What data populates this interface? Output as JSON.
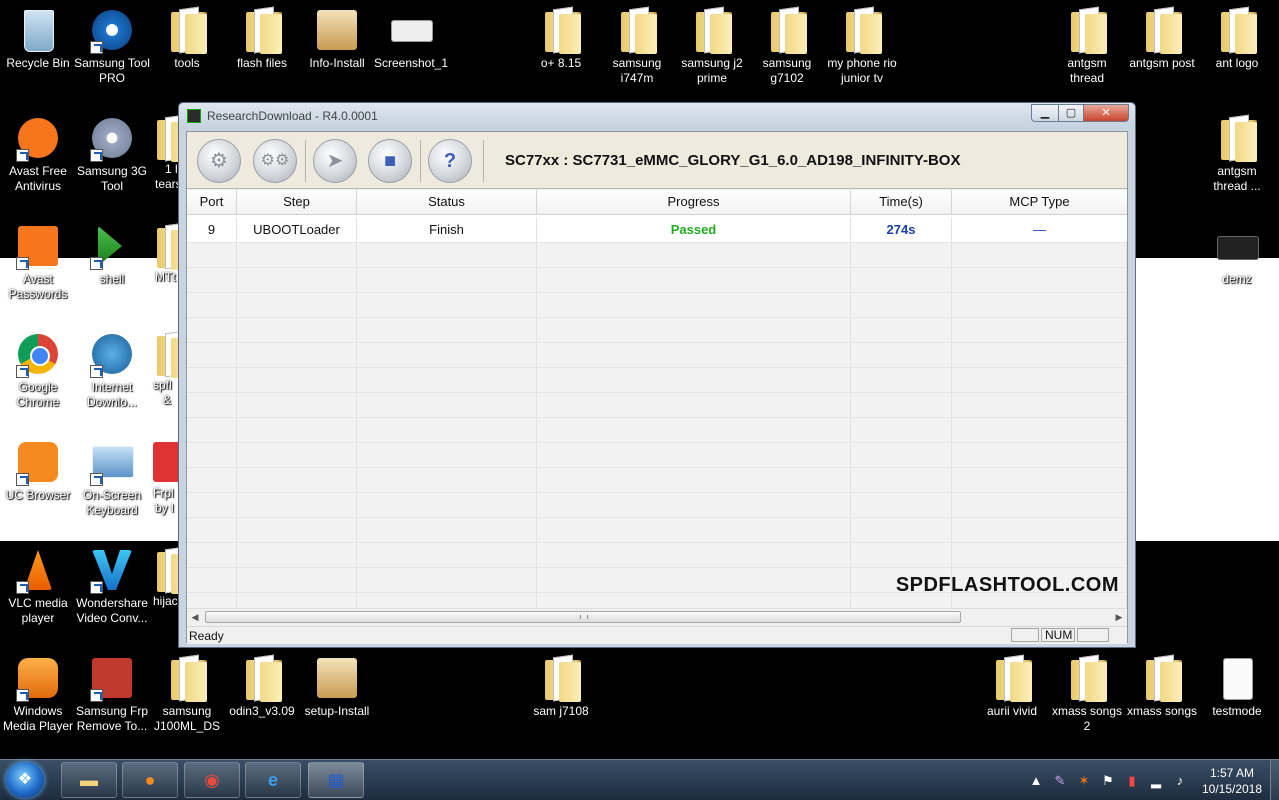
{
  "desktop": {
    "icons_left": [
      {
        "label": "Recycle Bin"
      },
      {
        "label": "Samsung Tool PRO"
      },
      {
        "label": "tools"
      },
      {
        "label": "flash files"
      },
      {
        "label": "Info-Install"
      },
      {
        "label": "Screenshot_1"
      },
      {
        "label": "Avast Free Antivirus"
      },
      {
        "label": "Samsung 3G Tool"
      },
      {
        "label": "Avast Passwords"
      },
      {
        "label": "shell"
      },
      {
        "label": "Google Chrome"
      },
      {
        "label": "Internet Downlo..."
      },
      {
        "label": "UC Browser"
      },
      {
        "label": "On-Screen Keyboard"
      },
      {
        "label": "VLC media player"
      },
      {
        "label": "Wondershare Video Conv..."
      },
      {
        "label": "Windows Media Player"
      },
      {
        "label": "Samsung Frp Remove To..."
      },
      {
        "label": "samsung J100ML_DS"
      },
      {
        "label": "odin3_v3.09"
      },
      {
        "label": "setup-Install"
      }
    ],
    "partial_labels": [
      "1 l",
      "tears",
      "MTt",
      "spfl",
      "&",
      "Frpl",
      "by l",
      "hijac"
    ],
    "icons_middle": [
      {
        "label": "o+ 8.15"
      },
      {
        "label": "samsung i747m"
      },
      {
        "label": "samsung j2 prime"
      },
      {
        "label": "samsung g7102"
      },
      {
        "label": "my phone rio junior tv"
      },
      {
        "label": "sam j7108"
      }
    ],
    "icons_right": [
      {
        "label": "antgsm thread"
      },
      {
        "label": "antgsm post"
      },
      {
        "label": "ant logo"
      },
      {
        "label": "antgsm thread ..."
      },
      {
        "label": "demz"
      },
      {
        "label": "aurii vivid"
      },
      {
        "label": "xmass songs 2"
      },
      {
        "label": "xmass songs"
      },
      {
        "label": "testmode"
      }
    ]
  },
  "window": {
    "title": "ResearchDownload - R4.0.0001",
    "controls": {
      "minimize": "▁",
      "maximize": "▢",
      "close": "✕"
    },
    "toolbar": {
      "buttons": [
        {
          "name": "load-packet-button",
          "icon": "gear-icon"
        },
        {
          "name": "settings-button",
          "icon": "double-gear-icon"
        },
        {
          "name": "start-download-button",
          "icon": "play-arrow-icon"
        },
        {
          "name": "stop-download-button",
          "icon": "stop-icon"
        },
        {
          "name": "help-button",
          "icon": "question-icon"
        }
      ],
      "device_title": "SC77xx : SC7731_eMMC_GLORY_G1_6.0_AD198_INFINITY-BOX"
    },
    "table": {
      "headers": [
        "Port",
        "Step",
        "Status",
        "Progress",
        "Time(s)",
        "MCP Type"
      ],
      "rows": [
        {
          "port": "9",
          "step": "UBOOTLoader",
          "status": "Finish",
          "progress": "Passed",
          "time": "274s",
          "mcp": "—"
        }
      ]
    },
    "watermark": "SPDFLASHTOOL.COM",
    "status": {
      "ready": "Ready",
      "num": "NUM"
    }
  },
  "taskbar": {
    "clock_time": "1:57 AM",
    "clock_date": "10/15/2018"
  }
}
